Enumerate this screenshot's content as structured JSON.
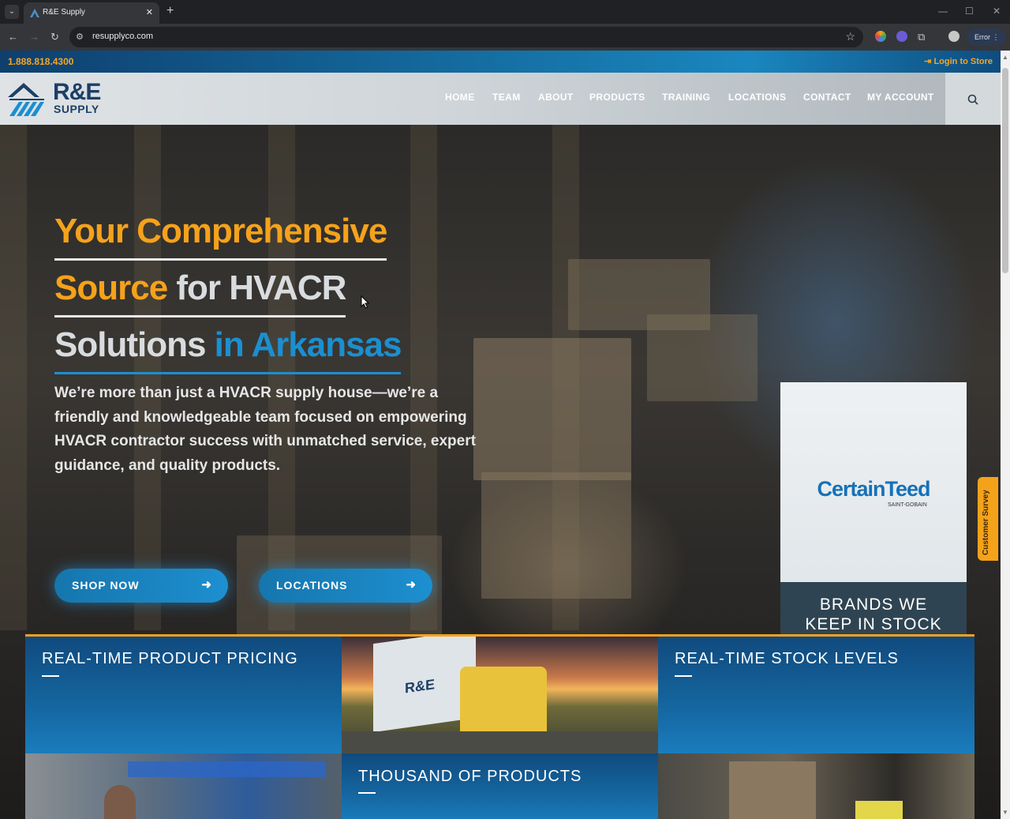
{
  "browser": {
    "tab_title": "R&E Supply",
    "url": "resupplyco.com",
    "status_pill": "Error"
  },
  "site": {
    "phone": "1.888.818.4300",
    "login": "Login to Store",
    "logo_main": "R&E",
    "logo_sub": "SUPPLY",
    "nav": [
      "HOME",
      "TEAM",
      "ABOUT",
      "PRODUCTS",
      "TRAINING",
      "LOCATIONS",
      "CONTACT",
      "MY ACCOUNT"
    ]
  },
  "hero": {
    "line1": "Your Comprehensive",
    "line2_a": "Source",
    "line2_b": " for HVACR",
    "line3_a": "Solutions",
    "line3_b": " in Arkansas",
    "paragraph": "We’re more than just a HVACR supply house—we’re a friendly and knowledgeable team focused on empowering HVACR contractor success with unmatched service, expert guidance, and quality products.",
    "btn_shop": "SHOP NOW",
    "btn_locations": "LOCATIONS"
  },
  "brands": {
    "logo": "CertainTeed",
    "logo_sub": "SAINT-GOBAIN",
    "label_1": "BRANDS WE",
    "label_2": "KEEP IN STOCK"
  },
  "survey": "Customer Survey",
  "tiles": {
    "pricing": "REAL-TIME PRODUCT PRICING",
    "stock": "REAL-TIME STOCK LEVELS",
    "products": "THOUSAND OF PRODUCTS",
    "truck_logo": "R&E"
  },
  "colors": {
    "accent_orange": "#f5a21b",
    "brand_blue": "#1b8fd0",
    "navy": "#1c3f66"
  }
}
